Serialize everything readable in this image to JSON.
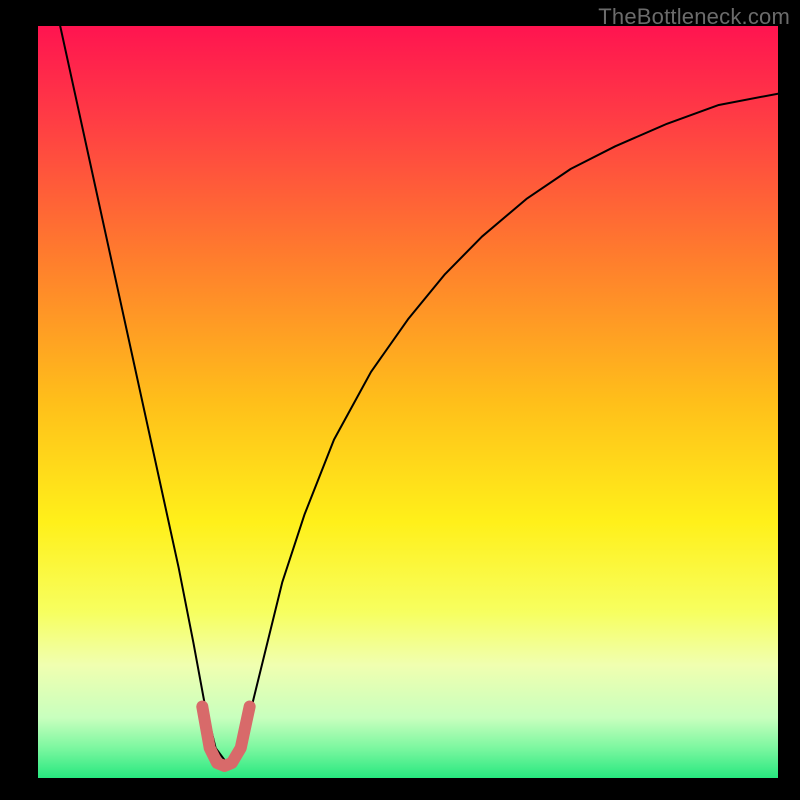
{
  "attribution": "TheBottleneck.com",
  "chart_data": {
    "type": "line",
    "title": "",
    "xlabel": "",
    "ylabel": "",
    "xlim": [
      0,
      100
    ],
    "ylim": [
      0,
      100
    ],
    "background_gradient": {
      "stops": [
        {
          "pos": 0.0,
          "color": "#ff1450"
        },
        {
          "pos": 0.12,
          "color": "#ff3b45"
        },
        {
          "pos": 0.3,
          "color": "#ff7a2e"
        },
        {
          "pos": 0.5,
          "color": "#ffbf1a"
        },
        {
          "pos": 0.66,
          "color": "#fff01a"
        },
        {
          "pos": 0.78,
          "color": "#f7ff60"
        },
        {
          "pos": 0.85,
          "color": "#f0ffb0"
        },
        {
          "pos": 0.92,
          "color": "#c8ffbe"
        },
        {
          "pos": 0.96,
          "color": "#7cf7a0"
        },
        {
          "pos": 1.0,
          "color": "#27e87f"
        }
      ]
    },
    "series": [
      {
        "name": "bottleneck-curve",
        "color": "#000000",
        "stroke_width": 2,
        "x": [
          3,
          5,
          7,
          9,
          11,
          13,
          15,
          17,
          19,
          21,
          22.5,
          24,
          25.5,
          27,
          29,
          31,
          33,
          36,
          40,
          45,
          50,
          55,
          60,
          66,
          72,
          78,
          85,
          92,
          100
        ],
        "y": [
          100,
          91,
          82,
          73,
          64,
          55,
          46,
          37,
          28,
          18,
          10,
          4,
          2,
          4,
          10,
          18,
          26,
          35,
          45,
          54,
          61,
          67,
          72,
          77,
          81,
          84,
          87,
          89.5,
          91
        ]
      },
      {
        "name": "optimal-zone-marker",
        "color": "#d86a6a",
        "stroke_width": 12,
        "linecap": "round",
        "x": [
          22.2,
          23.2,
          24.2,
          25.2,
          26.2,
          27.4,
          28.6
        ],
        "y": [
          9.5,
          4.0,
          2.0,
          1.6,
          2.0,
          4.0,
          9.5
        ]
      }
    ]
  }
}
